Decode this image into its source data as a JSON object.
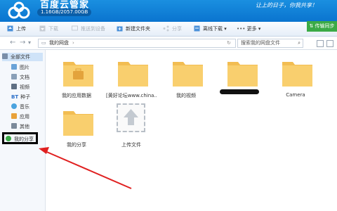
{
  "app": {
    "title": "百度云管家",
    "quota": "1.16GB/2057.00GB",
    "slogan": "让上的日子，你我共享！"
  },
  "toolbar": {
    "upload": "上传",
    "download": "下载",
    "push_device": "推送到设备",
    "new_folder": "新建文件夹",
    "share": "分享",
    "offline_download": "离线下载",
    "more": "更多",
    "sync_disk": "传输同步"
  },
  "nav": {
    "path_root": "我的网盘",
    "search_placeholder": "搜索我的网盘文件"
  },
  "sidebar": {
    "all_files": "全部文件",
    "items": [
      "图片",
      "文档",
      "视频",
      "种子",
      "音乐",
      "应用",
      "其他"
    ],
    "my_share": "我的分享"
  },
  "files": [
    {
      "name": "我的应用数据",
      "type": "app-folder"
    },
    {
      "name": "[黄好论坛www.china...",
      "type": "folder"
    },
    {
      "name": "我的视频",
      "type": "folder"
    },
    {
      "name": "",
      "type": "folder-redacted"
    },
    {
      "name": "Camera",
      "type": "folder"
    },
    {
      "name": "我的分享",
      "type": "folder"
    },
    {
      "name": "上传文件",
      "type": "upload"
    }
  ],
  "colors": {
    "header": "#0a74cf",
    "folder": "#f7c860",
    "sync_button": "#3aaa46",
    "annotation_arrow": "#e02020"
  }
}
